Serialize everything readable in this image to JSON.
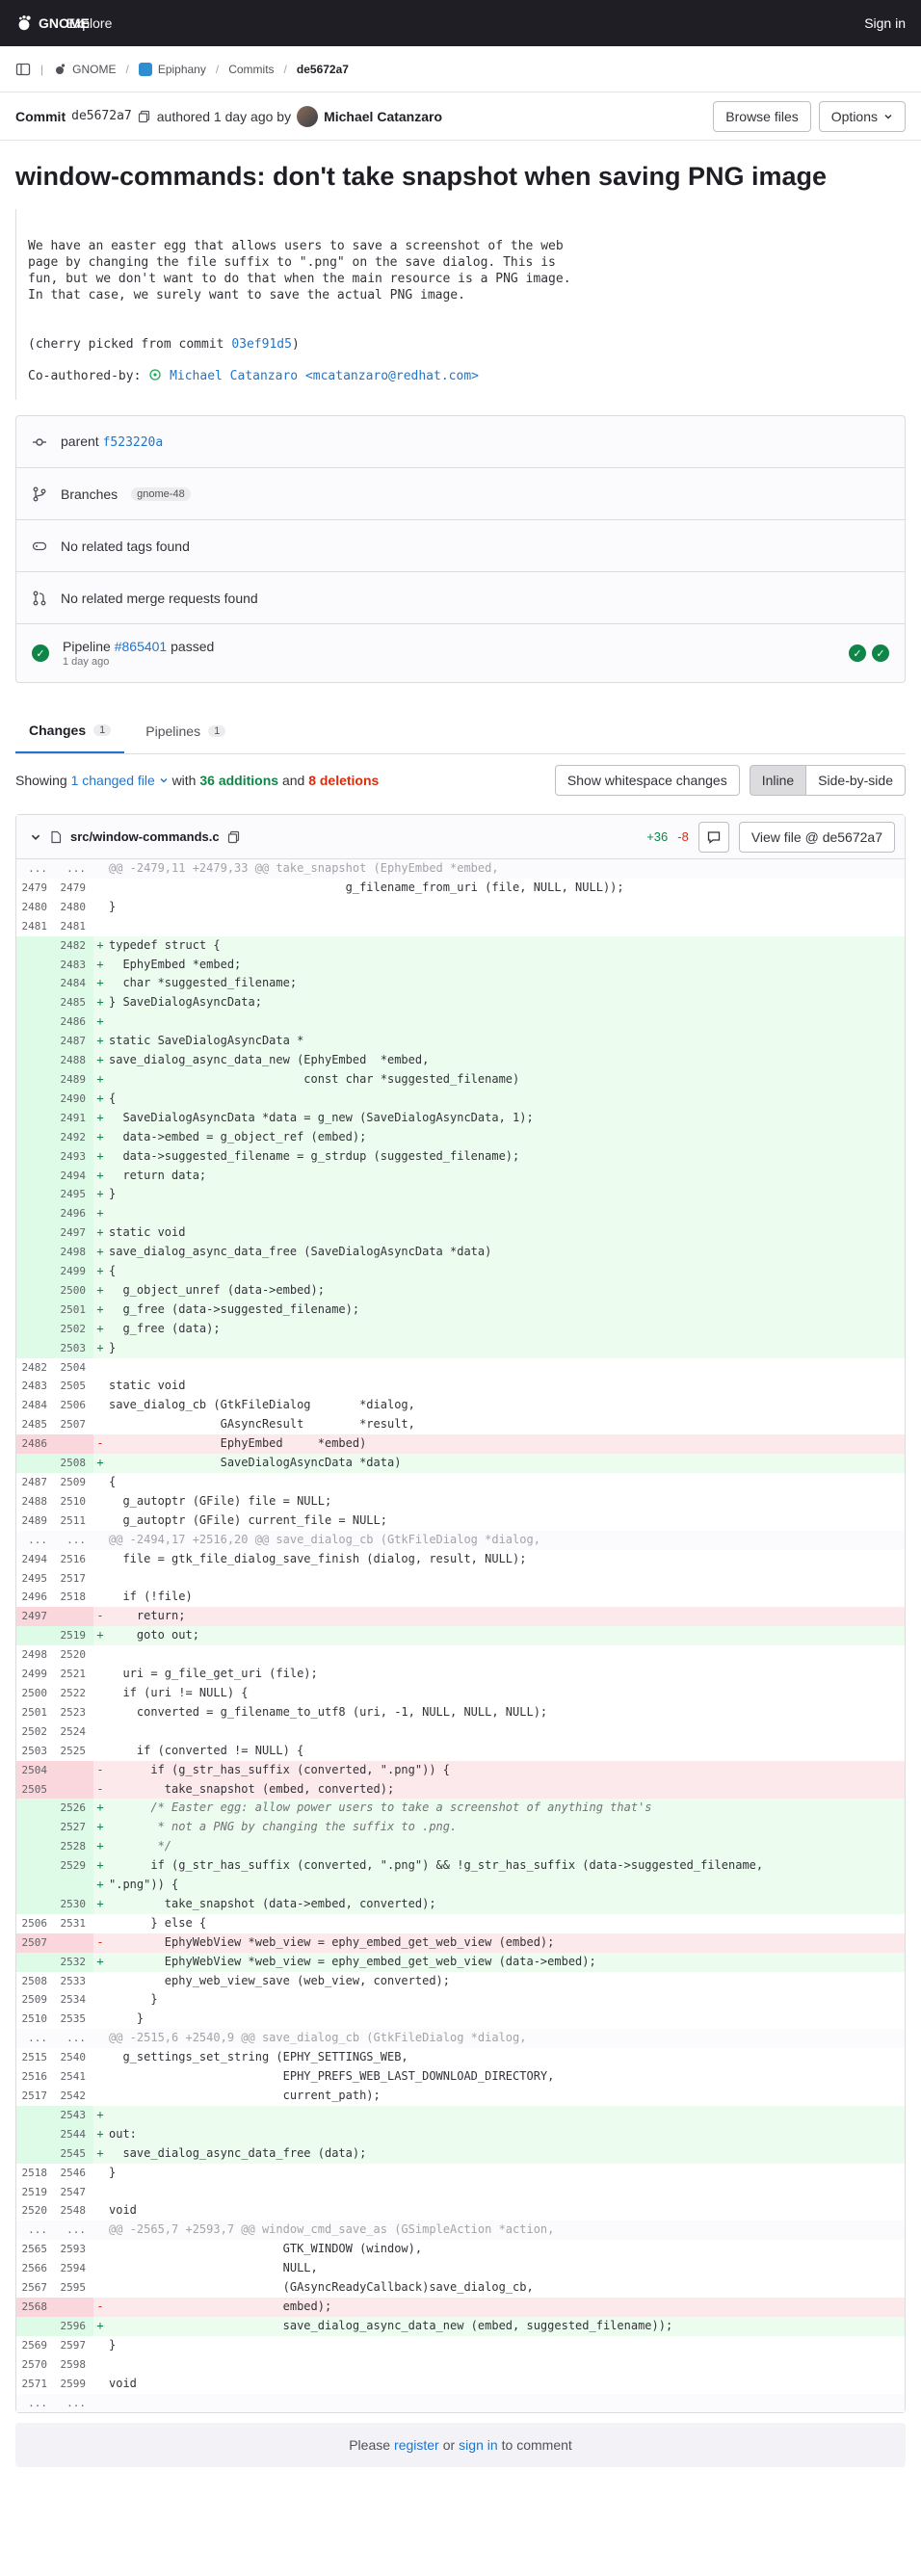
{
  "nav": {
    "brand": "GNOME",
    "explore": "Explore",
    "signin": "Sign in"
  },
  "breadcrumb": [
    {
      "label": "GNOME"
    },
    {
      "label": "Epiphany"
    },
    {
      "label": "Commits"
    },
    {
      "label": "de5672a7"
    }
  ],
  "commit": {
    "prefix": "Commit",
    "sha": "de5672a7",
    "authored": "authored 1 day ago by",
    "author": "Michael Catanzaro",
    "browse_files": "Browse files",
    "options": "Options",
    "title": "window-commands: don't take snapshot when saving PNG image",
    "message_p1": "We have an easter egg that allows users to save a screenshot of the web\npage by changing the file suffix to \".png\" on the save dialog. This is\nfun, but we don't want to do that when the main resource is a PNG image.\nIn that case, we surely want to save the actual PNG image.",
    "cherry_prefix": "(cherry picked from commit ",
    "cherry_sha": "03ef91d5",
    "cherry_suffix": ")",
    "coauthor_prefix": "Co-authored-by: ",
    "coauthor_name": "Michael Catanzaro",
    "coauthor_email": "<mcatanzaro@redhat.com>"
  },
  "info": {
    "parent_label": "parent",
    "parent_sha": "f523220a",
    "branches_label": "Branches",
    "branch": "gnome-48",
    "no_tags": "No related tags found",
    "no_mrs": "No related merge requests found",
    "pipeline_label": "Pipeline",
    "pipeline_id": "#865401",
    "pipeline_status": "passed",
    "pipeline_time": "1 day ago"
  },
  "tabs": [
    {
      "label": "Changes",
      "count": "1"
    },
    {
      "label": "Pipelines",
      "count": "1"
    }
  ],
  "diffbar": {
    "showing": "Showing",
    "changed": "1 changed file",
    "with": "with",
    "additions": "36 additions",
    "and": "and",
    "deletions": "8 deletions",
    "whitespace": "Show whitespace changes",
    "inline": "Inline",
    "side": "Side-by-side"
  },
  "file": {
    "path": "src/window-commands.c",
    "plus": "+36",
    "minus": "-8",
    "view_file": "View file @ de5672a7"
  },
  "diff_lines": [
    {
      "t": "hunk",
      "o": "...",
      "n": "...",
      "c": "@@ -2479,11 +2479,33 @@ take_snapshot (EphyEmbed *embed,"
    },
    {
      "t": "ctx",
      "o": "2479",
      "n": "2479",
      "c": "                                  g_filename_from_uri (file, NULL, NULL));"
    },
    {
      "t": "ctx",
      "o": "2480",
      "n": "2480",
      "c": "}"
    },
    {
      "t": "ctx",
      "o": "2481",
      "n": "2481",
      "c": ""
    },
    {
      "t": "add",
      "o": "",
      "n": "2482",
      "c": "typedef struct {"
    },
    {
      "t": "add",
      "o": "",
      "n": "2483",
      "c": "  EphyEmbed *embed;"
    },
    {
      "t": "add",
      "o": "",
      "n": "2484",
      "c": "  char *suggested_filename;"
    },
    {
      "t": "add",
      "o": "",
      "n": "2485",
      "c": "} SaveDialogAsyncData;"
    },
    {
      "t": "add",
      "o": "",
      "n": "2486",
      "c": ""
    },
    {
      "t": "add",
      "o": "",
      "n": "2487",
      "c": "static SaveDialogAsyncData *"
    },
    {
      "t": "add",
      "o": "",
      "n": "2488",
      "c": "save_dialog_async_data_new (EphyEmbed  *embed,"
    },
    {
      "t": "add",
      "o": "",
      "n": "2489",
      "c": "                            const char *suggested_filename)"
    },
    {
      "t": "add",
      "o": "",
      "n": "2490",
      "c": "{"
    },
    {
      "t": "add",
      "o": "",
      "n": "2491",
      "c": "  SaveDialogAsyncData *data = g_new (SaveDialogAsyncData, 1);"
    },
    {
      "t": "add",
      "o": "",
      "n": "2492",
      "c": "  data->embed = g_object_ref (embed);"
    },
    {
      "t": "add",
      "o": "",
      "n": "2493",
      "c": "  data->suggested_filename = g_strdup (suggested_filename);"
    },
    {
      "t": "add",
      "o": "",
      "n": "2494",
      "c": "  return data;"
    },
    {
      "t": "add",
      "o": "",
      "n": "2495",
      "c": "}"
    },
    {
      "t": "add",
      "o": "",
      "n": "2496",
      "c": ""
    },
    {
      "t": "add",
      "o": "",
      "n": "2497",
      "c": "static void"
    },
    {
      "t": "add",
      "o": "",
      "n": "2498",
      "c": "save_dialog_async_data_free (SaveDialogAsyncData *data)"
    },
    {
      "t": "add",
      "o": "",
      "n": "2499",
      "c": "{"
    },
    {
      "t": "add",
      "o": "",
      "n": "2500",
      "c": "  g_object_unref (data->embed);"
    },
    {
      "t": "add",
      "o": "",
      "n": "2501",
      "c": "  g_free (data->suggested_filename);"
    },
    {
      "t": "add",
      "o": "",
      "n": "2502",
      "c": "  g_free (data);"
    },
    {
      "t": "add",
      "o": "",
      "n": "2503",
      "c": "}"
    },
    {
      "t": "ctx",
      "o": "2482",
      "n": "2504",
      "c": ""
    },
    {
      "t": "ctx",
      "o": "2483",
      "n": "2505",
      "c": "static void"
    },
    {
      "t": "ctx",
      "o": "2484",
      "n": "2506",
      "c": "save_dialog_cb (GtkFileDialog       *dialog,"
    },
    {
      "t": "ctx",
      "o": "2485",
      "n": "2507",
      "c": "                GAsyncResult        *result,"
    },
    {
      "t": "del",
      "o": "2486",
      "n": "",
      "c": "                EphyEmbed     *embed)"
    },
    {
      "t": "add",
      "o": "",
      "n": "2508",
      "c": "                SaveDialogAsyncData *data)"
    },
    {
      "t": "ctx",
      "o": "2487",
      "n": "2509",
      "c": "{"
    },
    {
      "t": "ctx",
      "o": "2488",
      "n": "2510",
      "c": "  g_autoptr (GFile) file = NULL;"
    },
    {
      "t": "ctx",
      "o": "2489",
      "n": "2511",
      "c": "  g_autoptr (GFile) current_file = NULL;"
    },
    {
      "t": "hunk",
      "o": "...",
      "n": "...",
      "c": "@@ -2494,17 +2516,20 @@ save_dialog_cb (GtkFileDialog *dialog,"
    },
    {
      "t": "ctx",
      "o": "2494",
      "n": "2516",
      "c": "  file = gtk_file_dialog_save_finish (dialog, result, NULL);"
    },
    {
      "t": "ctx",
      "o": "2495",
      "n": "2517",
      "c": ""
    },
    {
      "t": "ctx",
      "o": "2496",
      "n": "2518",
      "c": "  if (!file)"
    },
    {
      "t": "del",
      "o": "2497",
      "n": "",
      "c": "    return;"
    },
    {
      "t": "add",
      "o": "",
      "n": "2519",
      "c": "    goto out;"
    },
    {
      "t": "ctx",
      "o": "2498",
      "n": "2520",
      "c": ""
    },
    {
      "t": "ctx",
      "o": "2499",
      "n": "2521",
      "c": "  uri = g_file_get_uri (file);"
    },
    {
      "t": "ctx",
      "o": "2500",
      "n": "2522",
      "c": "  if (uri != NULL) {"
    },
    {
      "t": "ctx",
      "o": "2501",
      "n": "2523",
      "c": "    converted = g_filename_to_utf8 (uri, -1, NULL, NULL, NULL);"
    },
    {
      "t": "ctx",
      "o": "2502",
      "n": "2524",
      "c": ""
    },
    {
      "t": "ctx",
      "o": "2503",
      "n": "2525",
      "c": "    if (converted != NULL) {"
    },
    {
      "t": "del",
      "o": "2504",
      "n": "",
      "c": "      if (g_str_has_suffix (converted, \".png\")) {"
    },
    {
      "t": "del",
      "o": "2505",
      "n": "",
      "c": "        take_snapshot (embed, converted);"
    },
    {
      "t": "add",
      "o": "",
      "n": "2526",
      "c": "      /* Easter egg: allow power users to take a screenshot of anything that's"
    },
    {
      "t": "add",
      "o": "",
      "n": "2527",
      "c": "       * not a PNG by changing the suffix to .png."
    },
    {
      "t": "add",
      "o": "",
      "n": "2528",
      "c": "       */"
    },
    {
      "t": "add",
      "o": "",
      "n": "2529",
      "c": "      if (g_str_has_suffix (converted, \".png\") && !g_str_has_suffix (data->suggested_filename,"
    },
    {
      "t": "add",
      "o": "",
      "n": "",
      "c": "\".png\")) {"
    },
    {
      "t": "add",
      "o": "",
      "n": "2530",
      "c": "        take_snapshot (data->embed, converted);"
    },
    {
      "t": "ctx",
      "o": "2506",
      "n": "2531",
      "c": "      } else {"
    },
    {
      "t": "del",
      "o": "2507",
      "n": "",
      "c": "        EphyWebView *web_view = ephy_embed_get_web_view (embed);"
    },
    {
      "t": "add",
      "o": "",
      "n": "2532",
      "c": "        EphyWebView *web_view = ephy_embed_get_web_view (data->embed);"
    },
    {
      "t": "ctx",
      "o": "2508",
      "n": "2533",
      "c": "        ephy_web_view_save (web_view, converted);"
    },
    {
      "t": "ctx",
      "o": "2509",
      "n": "2534",
      "c": "      }"
    },
    {
      "t": "ctx",
      "o": "2510",
      "n": "2535",
      "c": "    }"
    },
    {
      "t": "hunk",
      "o": "...",
      "n": "...",
      "c": "@@ -2515,6 +2540,9 @@ save_dialog_cb (GtkFileDialog *dialog,"
    },
    {
      "t": "ctx",
      "o": "2515",
      "n": "2540",
      "c": "  g_settings_set_string (EPHY_SETTINGS_WEB,"
    },
    {
      "t": "ctx",
      "o": "2516",
      "n": "2541",
      "c": "                         EPHY_PREFS_WEB_LAST_DOWNLOAD_DIRECTORY,"
    },
    {
      "t": "ctx",
      "o": "2517",
      "n": "2542",
      "c": "                         current_path);"
    },
    {
      "t": "add",
      "o": "",
      "n": "2543",
      "c": ""
    },
    {
      "t": "add",
      "o": "",
      "n": "2544",
      "c": "out:"
    },
    {
      "t": "add",
      "o": "",
      "n": "2545",
      "c": "  save_dialog_async_data_free (data);"
    },
    {
      "t": "ctx",
      "o": "2518",
      "n": "2546",
      "c": "}"
    },
    {
      "t": "ctx",
      "o": "2519",
      "n": "2547",
      "c": ""
    },
    {
      "t": "ctx",
      "o": "2520",
      "n": "2548",
      "c": "void"
    },
    {
      "t": "hunk",
      "o": "...",
      "n": "...",
      "c": "@@ -2565,7 +2593,7 @@ window_cmd_save_as (GSimpleAction *action,"
    },
    {
      "t": "ctx",
      "o": "2565",
      "n": "2593",
      "c": "                         GTK_WINDOW (window),"
    },
    {
      "t": "ctx",
      "o": "2566",
      "n": "2594",
      "c": "                         NULL,"
    },
    {
      "t": "ctx",
      "o": "2567",
      "n": "2595",
      "c": "                         (GAsyncReadyCallback)save_dialog_cb,"
    },
    {
      "t": "del",
      "o": "2568",
      "n": "",
      "c": "                         embed);"
    },
    {
      "t": "add",
      "o": "",
      "n": "2596",
      "c": "                         save_dialog_async_data_new (embed, suggested_filename));"
    },
    {
      "t": "ctx",
      "o": "2569",
      "n": "2597",
      "c": "}"
    },
    {
      "t": "ctx",
      "o": "2570",
      "n": "2598",
      "c": ""
    },
    {
      "t": "ctx",
      "o": "2571",
      "n": "2599",
      "c": "void"
    },
    {
      "t": "hunk",
      "o": "...",
      "n": "...",
      "c": ""
    }
  ],
  "footer": {
    "please": "Please",
    "register": "register",
    "or": "or",
    "signin": "sign in",
    "to_comment": "to comment"
  }
}
